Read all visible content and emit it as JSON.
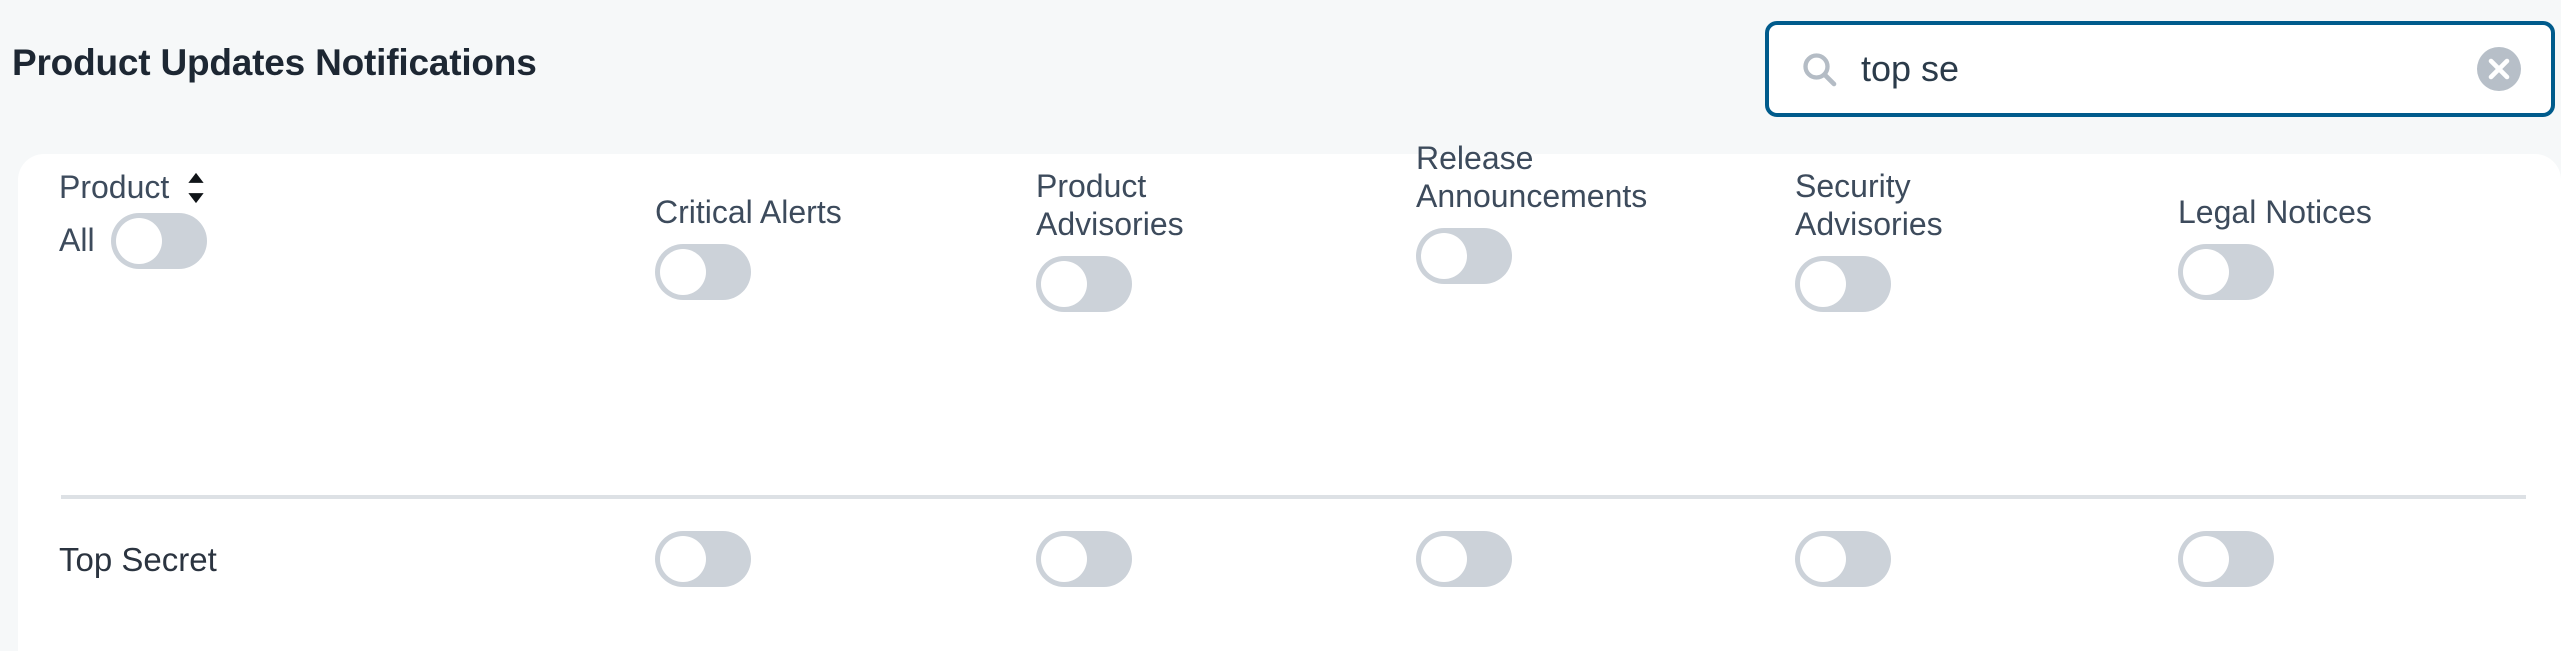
{
  "page": {
    "title": "Product Updates Notifications",
    "background_color": "#f6f8f9",
    "panel_color": "#ffffff"
  },
  "search": {
    "value": "top se",
    "placeholder": "",
    "icon": "search-icon",
    "clear_icon": "clear-circle-icon",
    "focused": true,
    "border_color": "#005b8c"
  },
  "table": {
    "sort_icon": "sort-updown-icon",
    "product_column_label": "Product",
    "all_label": "All",
    "columns": [
      {
        "label": "Critical Alerts",
        "toggle_on": false
      },
      {
        "label": "Product Advisories",
        "toggle_on": false
      },
      {
        "label": "Release Announcements",
        "toggle_on": false
      },
      {
        "label": "Security Advisories",
        "toggle_on": false
      },
      {
        "label": "Legal Notices",
        "toggle_on": false
      }
    ],
    "all_toggle_on": false,
    "rows": [
      {
        "product": "Top Secret",
        "toggles": [
          false,
          false,
          false,
          false,
          false
        ]
      }
    ],
    "toggle_off_track_color": "#ccd2d9",
    "toggle_knob_color": "#ffffff",
    "divider_color": "#dde1e5"
  }
}
